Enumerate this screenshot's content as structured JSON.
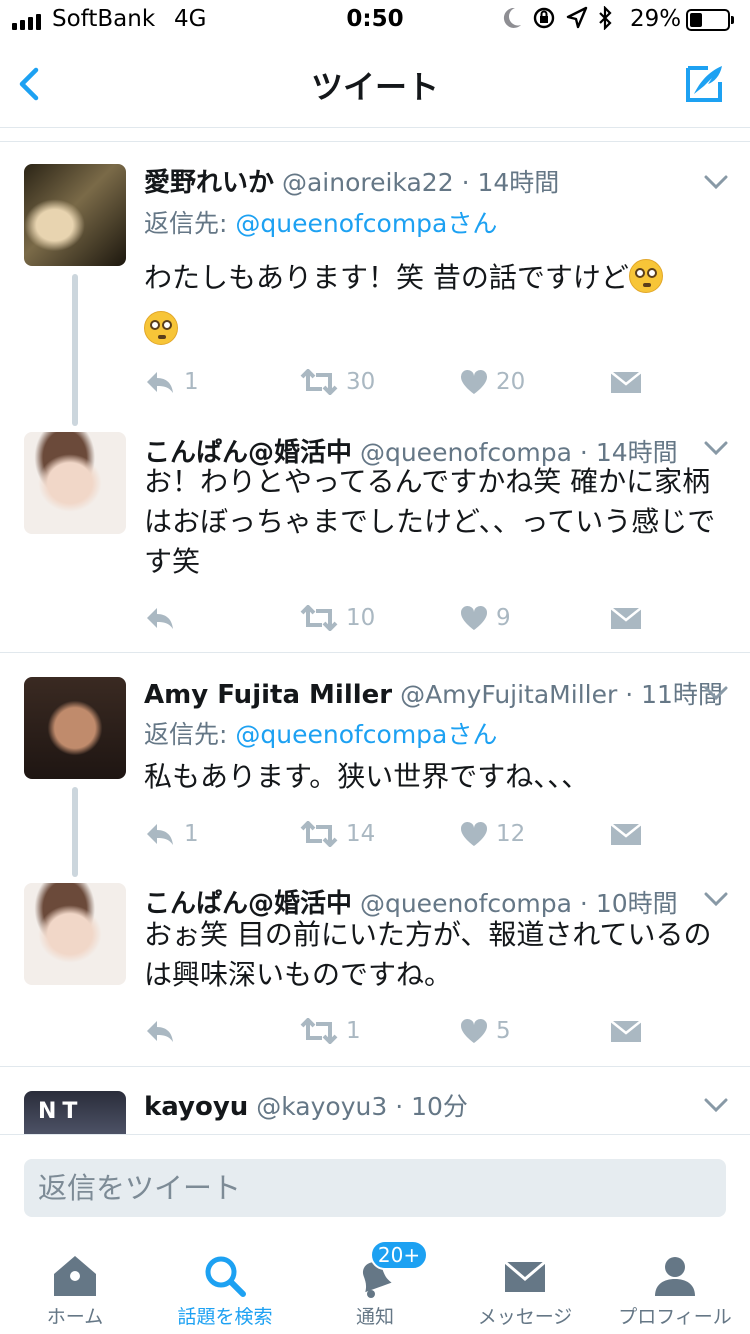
{
  "status_bar": {
    "carrier": "SoftBank",
    "network": "4G",
    "time": "0:50",
    "battery_percent": "29%",
    "battery_level": 0.29
  },
  "nav": {
    "title": "ツイート",
    "back_icon": "chevron-left-icon",
    "compose_icon": "compose-tweet-icon"
  },
  "tweets": [
    {
      "name": "愛野れいか",
      "handle": "@ainoreika22",
      "dot": "·",
      "time": "14時間",
      "reply_prefix": "返信先: ",
      "reply_to": "@queenofcompaさん",
      "text": "わたしもあります！笑 昔の話ですけど",
      "emoji": "flushed-face-emoji",
      "replies": "1",
      "retweets": "30",
      "likes": "20"
    },
    {
      "name": "こんぱん@婚活中",
      "handle": "@queenofcompa",
      "dot": "·",
      "time": "14時間",
      "text": "お！わりとやってるんですかね笑 確かに家柄はおぼっちゃまでしたけど、、っていう感じです笑",
      "replies": "",
      "retweets": "10",
      "likes": "9"
    },
    {
      "name": "Amy Fujita Miller",
      "handle": "@AmyFujitaMiller",
      "dot": "·",
      "time": "11時間",
      "reply_prefix": "返信先: ",
      "reply_to": "@queenofcompaさん",
      "text": "私もあります。狭い世界ですね、、、",
      "replies": "1",
      "retweets": "14",
      "likes": "12"
    },
    {
      "name": "こんぱん@婚活中",
      "handle": "@queenofcompa",
      "dot": "·",
      "time": "10時間",
      "text": "おぉ笑 目の前にいた方が、報道されているのは興味深いものですね。",
      "replies": "",
      "retweets": "1",
      "likes": "5"
    },
    {
      "name": "kayoyu",
      "handle": "@kayoyu3",
      "dot": "·",
      "time": "10分",
      "avatar_text": "NT"
    }
  ],
  "reply_bar": {
    "placeholder": "返信をツイート"
  },
  "tabs": [
    {
      "label": "ホーム",
      "icon": "home-icon"
    },
    {
      "label": "話題を検索",
      "icon": "search-icon"
    },
    {
      "label": "通知",
      "icon": "bell-icon",
      "badge": "20+"
    },
    {
      "label": "メッセージ",
      "icon": "envelope-icon"
    },
    {
      "label": "プロフィール",
      "icon": "person-icon"
    }
  ],
  "colors": {
    "accent": "#1da1f2",
    "text": "#14171a",
    "muted": "#657786",
    "action_gray": "#aab8c2",
    "divider": "#e1e8ed"
  }
}
